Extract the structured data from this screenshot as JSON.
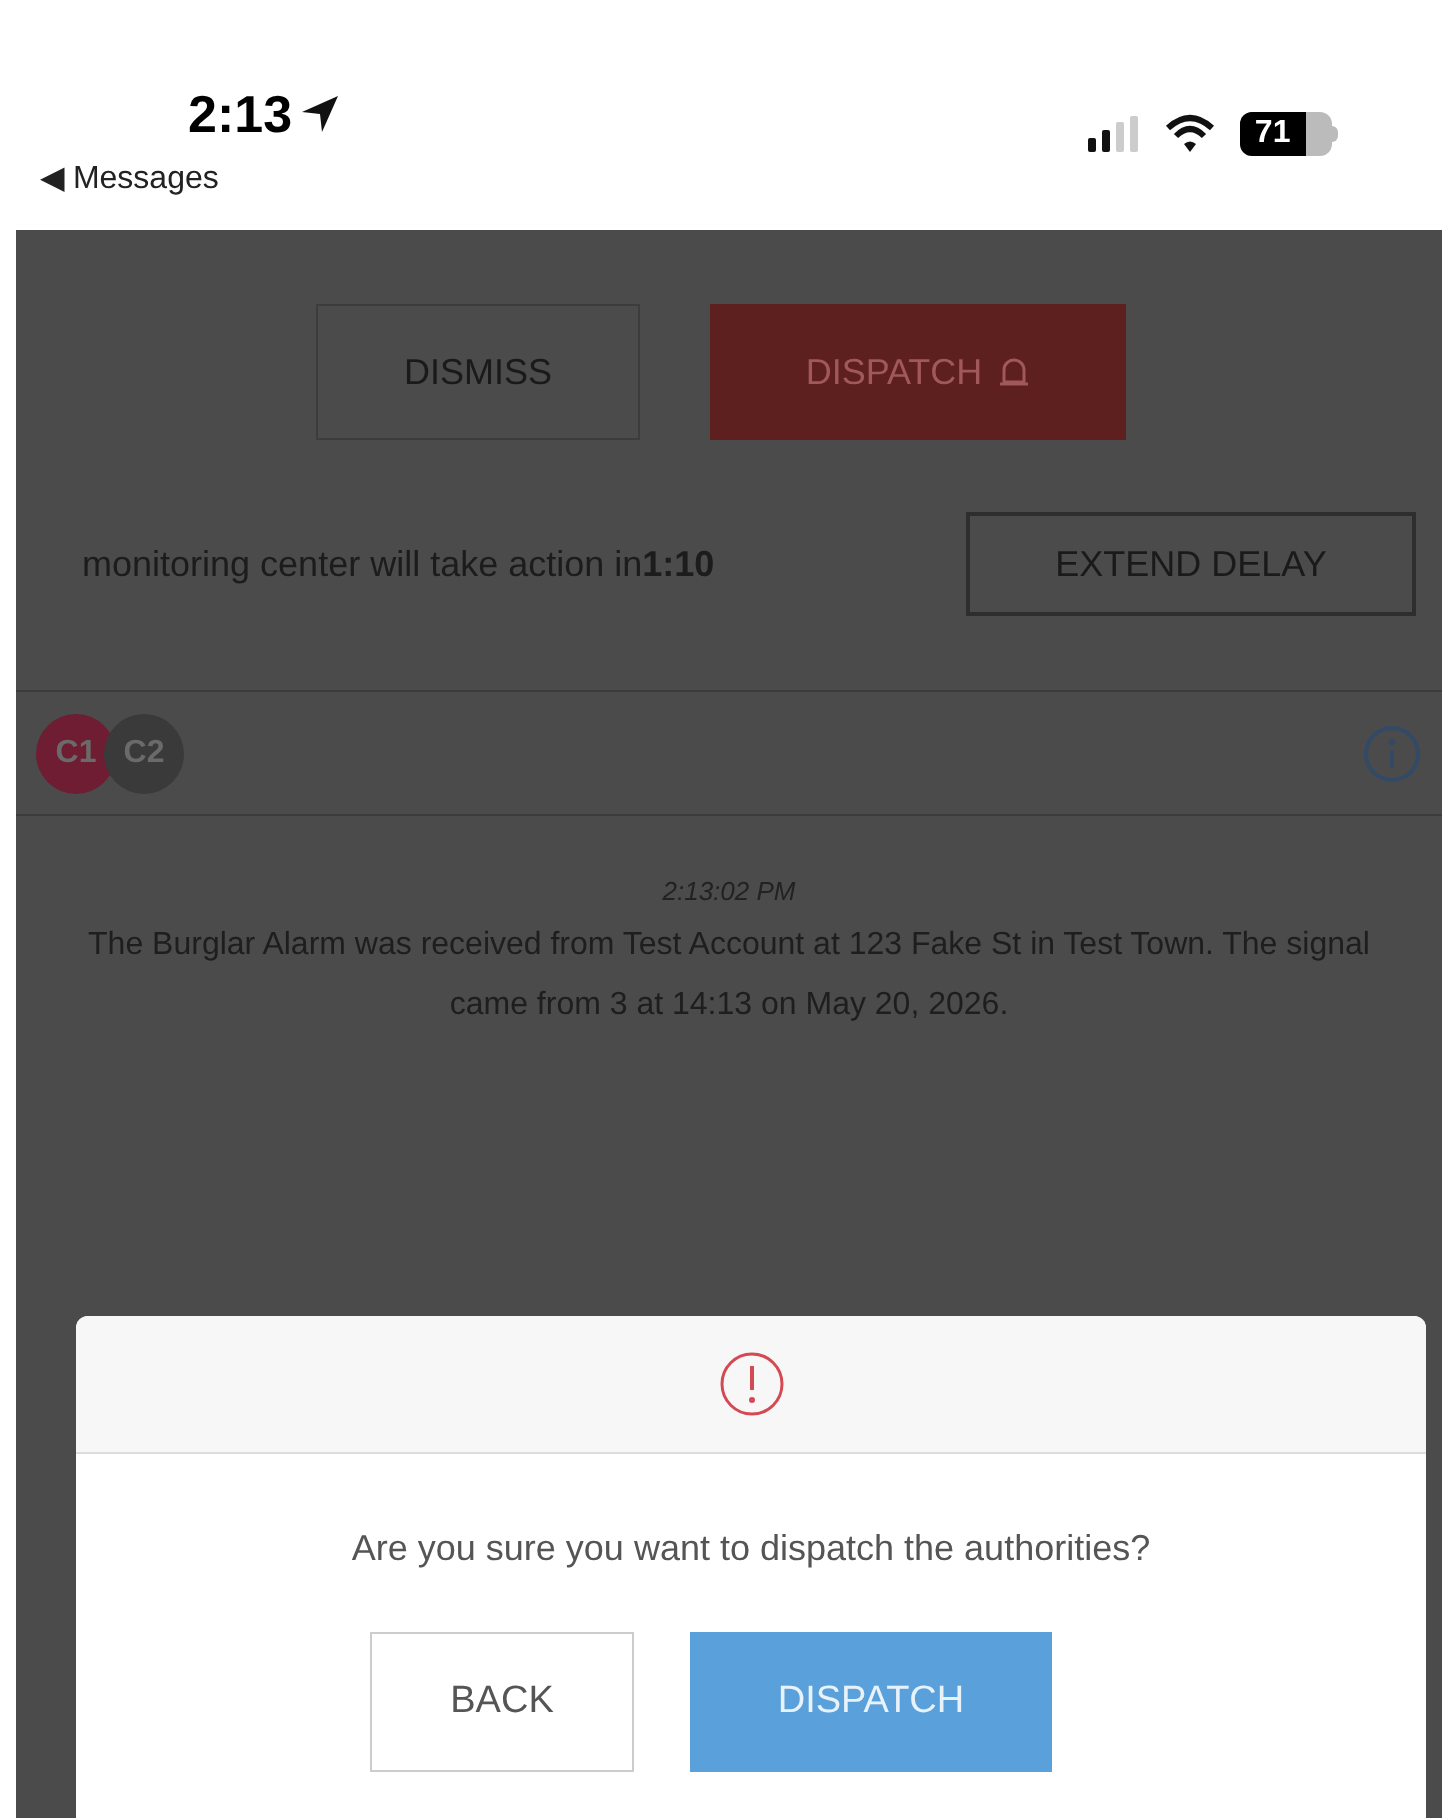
{
  "status_bar": {
    "time": "2:13",
    "back_label": "◀ Messages",
    "battery": "71"
  },
  "actions": {
    "dismiss": "DISMISS",
    "dispatch": "DISPATCH"
  },
  "countdown": {
    "text": "monitoring center will take action in**1:10**",
    "extend": "EXTEND DELAY"
  },
  "contacts": [
    {
      "label": "C1",
      "color": "#6e1d33"
    },
    {
      "label": "C2",
      "color": "#3a3a3a"
    }
  ],
  "event": {
    "time": "2:13:02 PM",
    "message": "The Burglar Alarm  was received from Test Account at 123 Fake St  in Test Town. The signal came from 3  at 14:13 on May 20, 2026."
  },
  "dialog": {
    "question": "Are you sure you want to dispatch the authorities?",
    "buttons": [
      {
        "label": "BACK",
        "kind": "secondary"
      },
      {
        "label": "DISPATCH",
        "kind": "primary"
      }
    ]
  }
}
